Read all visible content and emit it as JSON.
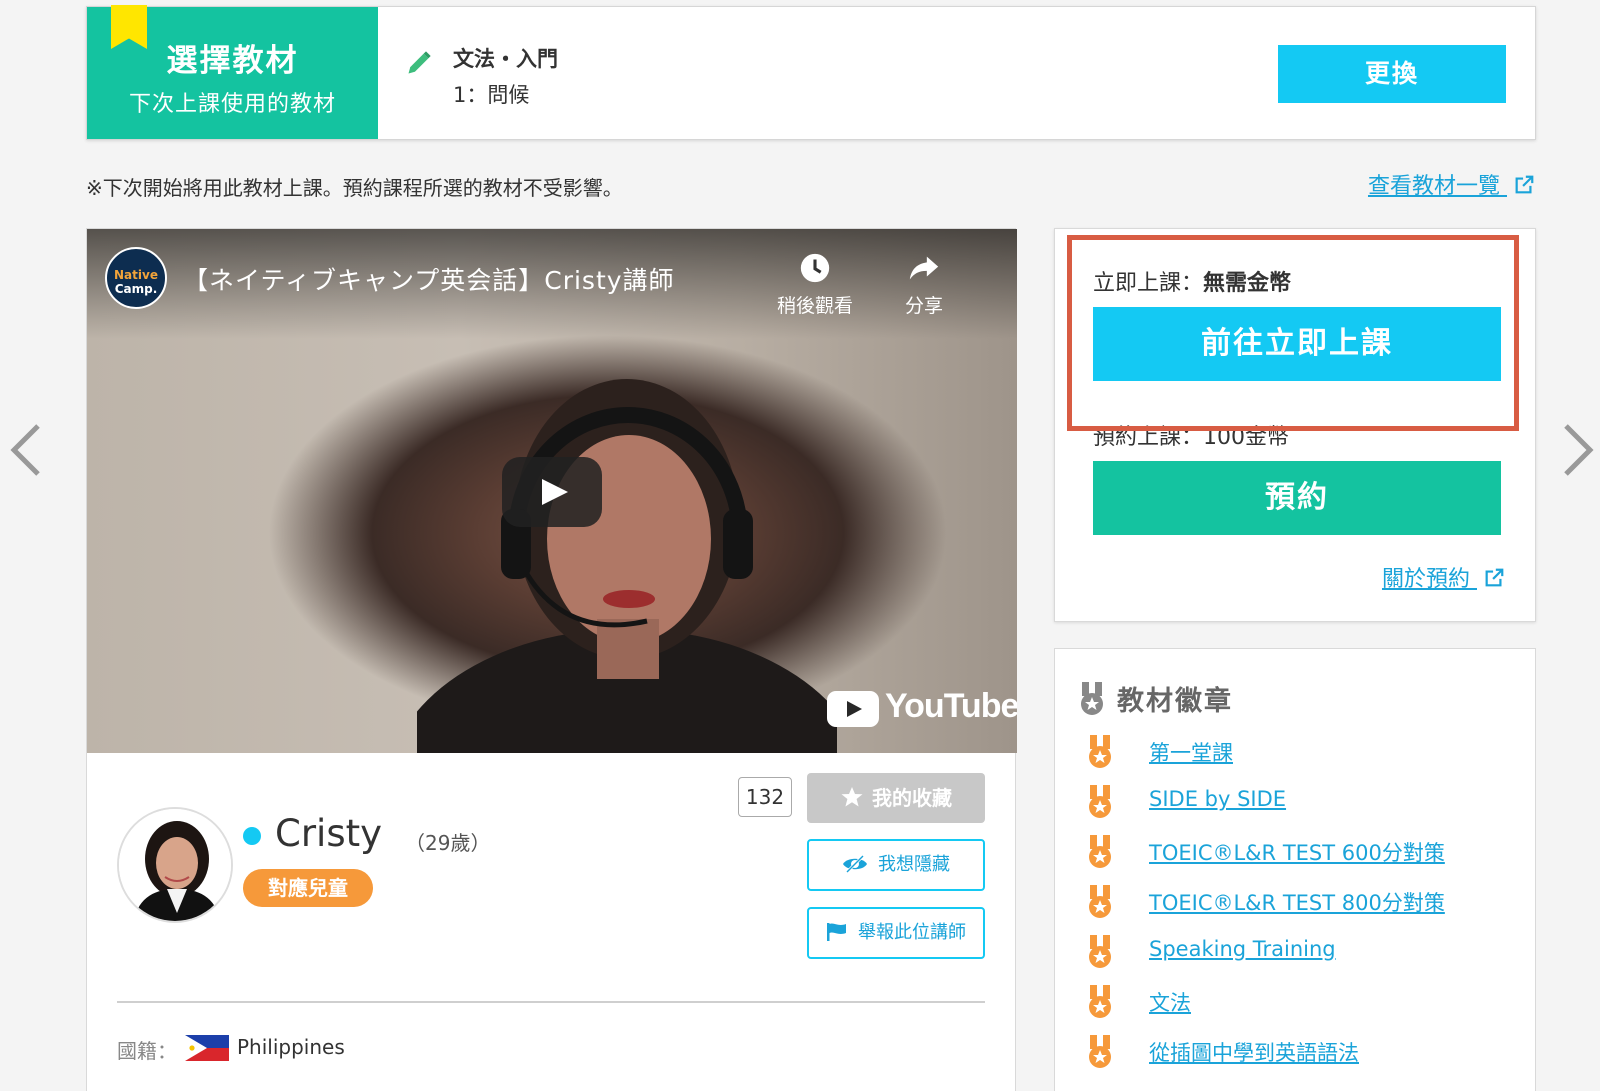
{
  "material": {
    "title": "選擇教材",
    "subtitle": "下次上課使用的教材",
    "category": "文法・入門",
    "lesson": "1：問候",
    "change_label": "更換"
  },
  "note": "※下次開始將用此教材上課。預約課程所選的教材不受影響。",
  "view_list_label": "查看教材一覽",
  "video": {
    "channel_logo_line1": "Native",
    "channel_logo_line2": "Camp.",
    "title": "【ネイティブキャンプ英会話】Cristy講師",
    "watch_later": "稍後觀看",
    "share": "分享",
    "brand": "YouTube"
  },
  "teacher": {
    "name": "Cristy",
    "age": "（29歲）",
    "kids_badge": "對應兒童",
    "favorite_count": "132",
    "favorite_label": "我的收藏",
    "hide_label": "我想隱藏",
    "report_label": "舉報此位講師",
    "nationality_label": "國籍：",
    "nationality": "Philippines"
  },
  "booking": {
    "instant_prefix": "立即上課：",
    "instant_value": "無需金幣",
    "instant_button": "前往立即上課",
    "reserve_label": "預約上課：100金幣",
    "reserve_button": "預約",
    "about_reserve": "關於預約"
  },
  "badges": {
    "heading": "教材徽章",
    "items": [
      "第一堂課",
      "SIDE by SIDE",
      "TOEIC®L&R TEST 600分對策",
      "TOEIC®L&R TEST 800分對策",
      "Speaking Training",
      "文法",
      "從插圖中學到英語語法"
    ]
  },
  "colors": {
    "cyan": "#14c9f3",
    "green": "#14c3a0",
    "orange": "#f6993a",
    "highlight_frame": "#d85c43",
    "link": "#1aa3d9"
  },
  "icons": [
    "pencil-icon",
    "external-link-icon",
    "clock-icon",
    "share-icon",
    "play-icon",
    "star-icon",
    "eye-slash-icon",
    "flag-icon",
    "medal-icon",
    "chevron-left-icon",
    "chevron-right-icon"
  ]
}
